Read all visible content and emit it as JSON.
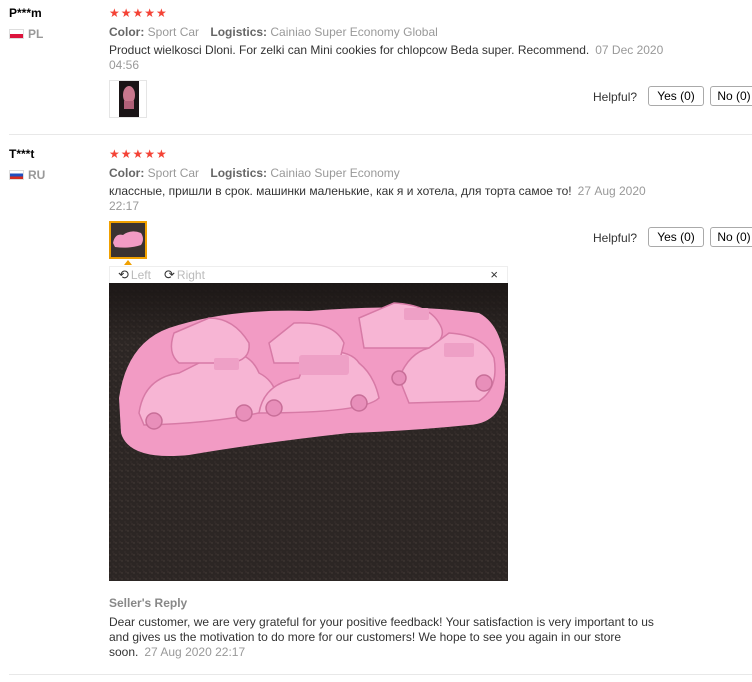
{
  "reviews": [
    {
      "user": "P***m",
      "country": "PL",
      "stars": "★★★★★",
      "color_label": "Color:",
      "color_value": "Sport Car",
      "logistics_label": "Logistics:",
      "logistics_value": "Cainiao Super Economy Global",
      "text": "Product wielkosci Dloni. For zelki can Mini cookies for chlopcow Beda super. Recommend.",
      "date": "07 Dec 2020 04:56",
      "helpful_label": "Helpful?",
      "yes_label": "Yes (0)",
      "no_label": "No (0)"
    },
    {
      "user": "T***t",
      "country": "RU",
      "stars": "★★★★★",
      "color_label": "Color:",
      "color_value": "Sport Car",
      "logistics_label": "Logistics:",
      "logistics_value": "Cainiao Super Economy",
      "text": "классные, пришли в срок. машинки маленькие, как я и хотела, для торта самое то!",
      "date": "27 Aug 2020 22:17",
      "helpful_label": "Helpful?",
      "yes_label": "Yes (0)",
      "no_label": "No (0)"
    }
  ],
  "viewer": {
    "left_label": "Left",
    "right_label": "Right",
    "close_symbol": "×"
  },
  "seller_reply": {
    "title": "Seller's Reply",
    "text": "Dear customer, we are very grateful for your positive feedback! Your satisfaction is very important to us and gives us the motivation to do more for our customers! We hope to see you again in our store soon.",
    "date": "27 Aug 2020 22:17"
  },
  "colors": {
    "star": "#f44336",
    "accent_border": "#f0a000",
    "mold_pink": "#f29bc4",
    "table_dark": "#2a2523"
  }
}
